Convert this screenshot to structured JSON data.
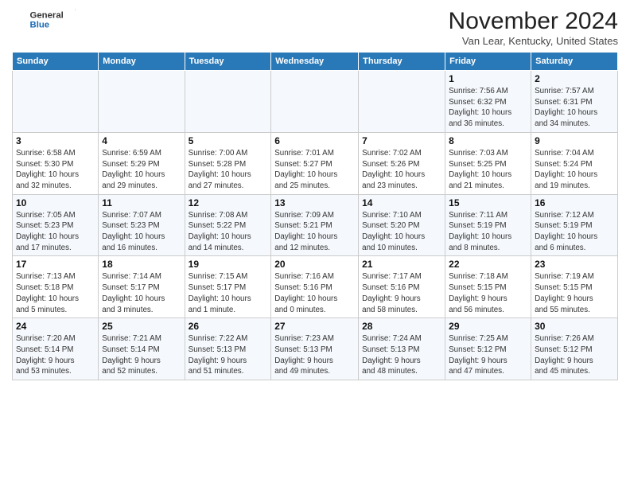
{
  "header": {
    "logo_line1": "General",
    "logo_line2": "Blue",
    "month_year": "November 2024",
    "location": "Van Lear, Kentucky, United States"
  },
  "weekdays": [
    "Sunday",
    "Monday",
    "Tuesday",
    "Wednesday",
    "Thursday",
    "Friday",
    "Saturday"
  ],
  "weeks": [
    [
      {
        "day": "",
        "info": ""
      },
      {
        "day": "",
        "info": ""
      },
      {
        "day": "",
        "info": ""
      },
      {
        "day": "",
        "info": ""
      },
      {
        "day": "",
        "info": ""
      },
      {
        "day": "1",
        "info": "Sunrise: 7:56 AM\nSunset: 6:32 PM\nDaylight: 10 hours\nand 36 minutes."
      },
      {
        "day": "2",
        "info": "Sunrise: 7:57 AM\nSunset: 6:31 PM\nDaylight: 10 hours\nand 34 minutes."
      }
    ],
    [
      {
        "day": "3",
        "info": "Sunrise: 6:58 AM\nSunset: 5:30 PM\nDaylight: 10 hours\nand 32 minutes."
      },
      {
        "day": "4",
        "info": "Sunrise: 6:59 AM\nSunset: 5:29 PM\nDaylight: 10 hours\nand 29 minutes."
      },
      {
        "day": "5",
        "info": "Sunrise: 7:00 AM\nSunset: 5:28 PM\nDaylight: 10 hours\nand 27 minutes."
      },
      {
        "day": "6",
        "info": "Sunrise: 7:01 AM\nSunset: 5:27 PM\nDaylight: 10 hours\nand 25 minutes."
      },
      {
        "day": "7",
        "info": "Sunrise: 7:02 AM\nSunset: 5:26 PM\nDaylight: 10 hours\nand 23 minutes."
      },
      {
        "day": "8",
        "info": "Sunrise: 7:03 AM\nSunset: 5:25 PM\nDaylight: 10 hours\nand 21 minutes."
      },
      {
        "day": "9",
        "info": "Sunrise: 7:04 AM\nSunset: 5:24 PM\nDaylight: 10 hours\nand 19 minutes."
      }
    ],
    [
      {
        "day": "10",
        "info": "Sunrise: 7:05 AM\nSunset: 5:23 PM\nDaylight: 10 hours\nand 17 minutes."
      },
      {
        "day": "11",
        "info": "Sunrise: 7:07 AM\nSunset: 5:23 PM\nDaylight: 10 hours\nand 16 minutes."
      },
      {
        "day": "12",
        "info": "Sunrise: 7:08 AM\nSunset: 5:22 PM\nDaylight: 10 hours\nand 14 minutes."
      },
      {
        "day": "13",
        "info": "Sunrise: 7:09 AM\nSunset: 5:21 PM\nDaylight: 10 hours\nand 12 minutes."
      },
      {
        "day": "14",
        "info": "Sunrise: 7:10 AM\nSunset: 5:20 PM\nDaylight: 10 hours\nand 10 minutes."
      },
      {
        "day": "15",
        "info": "Sunrise: 7:11 AM\nSunset: 5:19 PM\nDaylight: 10 hours\nand 8 minutes."
      },
      {
        "day": "16",
        "info": "Sunrise: 7:12 AM\nSunset: 5:19 PM\nDaylight: 10 hours\nand 6 minutes."
      }
    ],
    [
      {
        "day": "17",
        "info": "Sunrise: 7:13 AM\nSunset: 5:18 PM\nDaylight: 10 hours\nand 5 minutes."
      },
      {
        "day": "18",
        "info": "Sunrise: 7:14 AM\nSunset: 5:17 PM\nDaylight: 10 hours\nand 3 minutes."
      },
      {
        "day": "19",
        "info": "Sunrise: 7:15 AM\nSunset: 5:17 PM\nDaylight: 10 hours\nand 1 minute."
      },
      {
        "day": "20",
        "info": "Sunrise: 7:16 AM\nSunset: 5:16 PM\nDaylight: 10 hours\nand 0 minutes."
      },
      {
        "day": "21",
        "info": "Sunrise: 7:17 AM\nSunset: 5:16 PM\nDaylight: 9 hours\nand 58 minutes."
      },
      {
        "day": "22",
        "info": "Sunrise: 7:18 AM\nSunset: 5:15 PM\nDaylight: 9 hours\nand 56 minutes."
      },
      {
        "day": "23",
        "info": "Sunrise: 7:19 AM\nSunset: 5:15 PM\nDaylight: 9 hours\nand 55 minutes."
      }
    ],
    [
      {
        "day": "24",
        "info": "Sunrise: 7:20 AM\nSunset: 5:14 PM\nDaylight: 9 hours\nand 53 minutes."
      },
      {
        "day": "25",
        "info": "Sunrise: 7:21 AM\nSunset: 5:14 PM\nDaylight: 9 hours\nand 52 minutes."
      },
      {
        "day": "26",
        "info": "Sunrise: 7:22 AM\nSunset: 5:13 PM\nDaylight: 9 hours\nand 51 minutes."
      },
      {
        "day": "27",
        "info": "Sunrise: 7:23 AM\nSunset: 5:13 PM\nDaylight: 9 hours\nand 49 minutes."
      },
      {
        "day": "28",
        "info": "Sunrise: 7:24 AM\nSunset: 5:13 PM\nDaylight: 9 hours\nand 48 minutes."
      },
      {
        "day": "29",
        "info": "Sunrise: 7:25 AM\nSunset: 5:12 PM\nDaylight: 9 hours\nand 47 minutes."
      },
      {
        "day": "30",
        "info": "Sunrise: 7:26 AM\nSunset: 5:12 PM\nDaylight: 9 hours\nand 45 minutes."
      }
    ]
  ]
}
